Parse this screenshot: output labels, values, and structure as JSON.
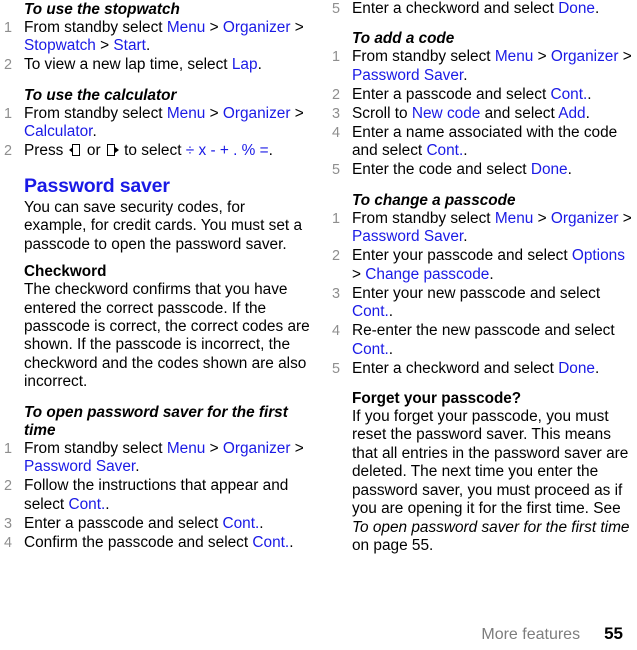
{
  "document": {
    "footer": {
      "chapter": "More features",
      "page_number": "55"
    }
  },
  "left_column": {
    "sections": [
      {
        "id": "stopwatch",
        "heading": "To use the stopwatch",
        "heading_style": "italic-bold",
        "steps": [
          {
            "num": "1",
            "parts": [
              {
                "t": "From standby select ",
                "s": "plain"
              },
              {
                "t": "Menu",
                "s": "link"
              },
              {
                "t": " > ",
                "s": "plain"
              },
              {
                "t": "Organizer",
                "s": "link"
              },
              {
                "t": " > ",
                "s": "plain"
              },
              {
                "t": "Stopwatch",
                "s": "link"
              },
              {
                "t": " > ",
                "s": "plain"
              },
              {
                "t": "Start",
                "s": "link"
              },
              {
                "t": ".",
                "s": "plain"
              }
            ]
          },
          {
            "num": "2",
            "parts": [
              {
                "t": "To view a new lap time, select ",
                "s": "plain"
              },
              {
                "t": "Lap",
                "s": "link"
              },
              {
                "t": ".",
                "s": "plain"
              }
            ]
          }
        ]
      },
      {
        "id": "calculator",
        "heading": "To use the calculator",
        "heading_style": "italic-bold",
        "steps": [
          {
            "num": "1",
            "parts": [
              {
                "t": "From standby select ",
                "s": "plain"
              },
              {
                "t": "Menu",
                "s": "link"
              },
              {
                "t": " > ",
                "s": "plain"
              },
              {
                "t": "Organizer",
                "s": "link"
              },
              {
                "t": " > ",
                "s": "plain"
              },
              {
                "t": "Calculator",
                "s": "link"
              },
              {
                "t": ".",
                "s": "plain"
              }
            ]
          },
          {
            "num": "2",
            "parts": [
              {
                "t": "Press ",
                "s": "plain"
              },
              {
                "t": "",
                "s": "icon-nav-left"
              },
              {
                "t": " or ",
                "s": "plain"
              },
              {
                "t": "",
                "s": "icon-nav-right"
              },
              {
                "t": " to select ",
                "s": "plain"
              },
              {
                "t": "÷ x - + . % =",
                "s": "link"
              },
              {
                "t": ".",
                "s": "plain"
              }
            ]
          }
        ]
      }
    ],
    "password_saver": {
      "heading": "Password saver",
      "intro": "You can save security codes, for example, for credit cards. You must set a passcode to open the password saver.",
      "checkword": {
        "heading": "Checkword",
        "body": "The checkword confirms that you have entered the correct passcode. If the passcode is correct, the correct codes are shown. If the passcode is incorrect, the checkword and the codes shown are also incorrect."
      },
      "first_time": {
        "heading": "To open password saver for the first time",
        "steps": [
          {
            "num": "1",
            "parts": [
              {
                "t": "From standby select ",
                "s": "plain"
              },
              {
                "t": "Menu",
                "s": "link"
              },
              {
                "t": " > ",
                "s": "plain"
              },
              {
                "t": "Organizer",
                "s": "link"
              },
              {
                "t": " > ",
                "s": "plain"
              },
              {
                "t": "Password Saver",
                "s": "link"
              },
              {
                "t": ".",
                "s": "plain"
              }
            ]
          },
          {
            "num": "2",
            "parts": [
              {
                "t": "Follow the instructions that appear and select ",
                "s": "plain"
              },
              {
                "t": "Cont.",
                "s": "link"
              },
              {
                "t": ".",
                "s": "plain"
              }
            ]
          },
          {
            "num": "3",
            "parts": [
              {
                "t": "Enter a passcode and select ",
                "s": "plain"
              },
              {
                "t": "Cont.",
                "s": "link"
              },
              {
                "t": ".",
                "s": "plain"
              }
            ]
          },
          {
            "num": "4",
            "parts": [
              {
                "t": "Confirm the passcode and select ",
                "s": "plain"
              },
              {
                "t": "Cont.",
                "s": "link"
              },
              {
                "t": ".",
                "s": "plain"
              }
            ]
          }
        ]
      }
    }
  },
  "right_column": {
    "continued_step": {
      "num": "5",
      "parts": [
        {
          "t": "Enter a checkword and select ",
          "s": "plain"
        },
        {
          "t": "Done",
          "s": "link"
        },
        {
          "t": ".",
          "s": "plain"
        }
      ]
    },
    "sections": [
      {
        "id": "add-a-code",
        "heading": "To add a code",
        "heading_style": "italic-bold",
        "steps": [
          {
            "num": "1",
            "parts": [
              {
                "t": "From standby select ",
                "s": "plain"
              },
              {
                "t": "Menu",
                "s": "link"
              },
              {
                "t": " > ",
                "s": "plain"
              },
              {
                "t": "Organizer",
                "s": "link"
              },
              {
                "t": " > ",
                "s": "plain"
              },
              {
                "t": "Password Saver",
                "s": "link"
              },
              {
                "t": ".",
                "s": "plain"
              }
            ]
          },
          {
            "num": "2",
            "parts": [
              {
                "t": "Enter a passcode and select ",
                "s": "plain"
              },
              {
                "t": "Cont.",
                "s": "link"
              },
              {
                "t": ".",
                "s": "plain"
              }
            ]
          },
          {
            "num": "3",
            "parts": [
              {
                "t": "Scroll to ",
                "s": "plain"
              },
              {
                "t": "New code",
                "s": "link"
              },
              {
                "t": " and select ",
                "s": "plain"
              },
              {
                "t": "Add",
                "s": "link"
              },
              {
                "t": ".",
                "s": "plain"
              }
            ]
          },
          {
            "num": "4",
            "parts": [
              {
                "t": "Enter a name associated with the code and select ",
                "s": "plain"
              },
              {
                "t": "Cont.",
                "s": "link"
              },
              {
                "t": ".",
                "s": "plain"
              }
            ]
          },
          {
            "num": "5",
            "parts": [
              {
                "t": "Enter the code and select ",
                "s": "plain"
              },
              {
                "t": "Done",
                "s": "link"
              },
              {
                "t": ".",
                "s": "plain"
              }
            ]
          }
        ]
      },
      {
        "id": "change-a-passcode",
        "heading": "To change a passcode",
        "heading_style": "italic-bold",
        "steps": [
          {
            "num": "1",
            "parts": [
              {
                "t": "From standby select ",
                "s": "plain"
              },
              {
                "t": "Menu",
                "s": "link"
              },
              {
                "t": " > ",
                "s": "plain"
              },
              {
                "t": "Organizer",
                "s": "link"
              },
              {
                "t": " > ",
                "s": "plain"
              },
              {
                "t": "Password Saver",
                "s": "link"
              },
              {
                "t": ".",
                "s": "plain"
              }
            ]
          },
          {
            "num": "2",
            "parts": [
              {
                "t": "Enter your passcode and select ",
                "s": "plain"
              },
              {
                "t": "Options",
                "s": "link"
              },
              {
                "t": " > ",
                "s": "plain"
              },
              {
                "t": "Change passcode",
                "s": "link"
              },
              {
                "t": ".",
                "s": "plain"
              }
            ]
          },
          {
            "num": "3",
            "parts": [
              {
                "t": "Enter your new passcode and select ",
                "s": "plain"
              },
              {
                "t": "Cont.",
                "s": "link"
              },
              {
                "t": ".",
                "s": "plain"
              }
            ]
          },
          {
            "num": "4",
            "parts": [
              {
                "t": "Re-enter the new passcode and select ",
                "s": "plain"
              },
              {
                "t": "Cont.",
                "s": "link"
              },
              {
                "t": ".",
                "s": "plain"
              }
            ]
          },
          {
            "num": "5",
            "parts": [
              {
                "t": "Enter a checkword and select ",
                "s": "plain"
              },
              {
                "t": "Done",
                "s": "link"
              },
              {
                "t": ".",
                "s": "plain"
              }
            ]
          }
        ]
      }
    ],
    "forget": {
      "heading": "Forget your passcode?",
      "body_parts": [
        {
          "t": "If you forget your passcode, you must reset the password saver. This means that all entries in the password saver are deleted. The next time you enter the password saver, you must proceed as if you are opening it for the first time. See ",
          "s": "plain"
        },
        {
          "t": "To open password saver for the first time",
          "s": "italic"
        },
        {
          "t": " on page 55.",
          "s": "plain"
        }
      ]
    }
  }
}
